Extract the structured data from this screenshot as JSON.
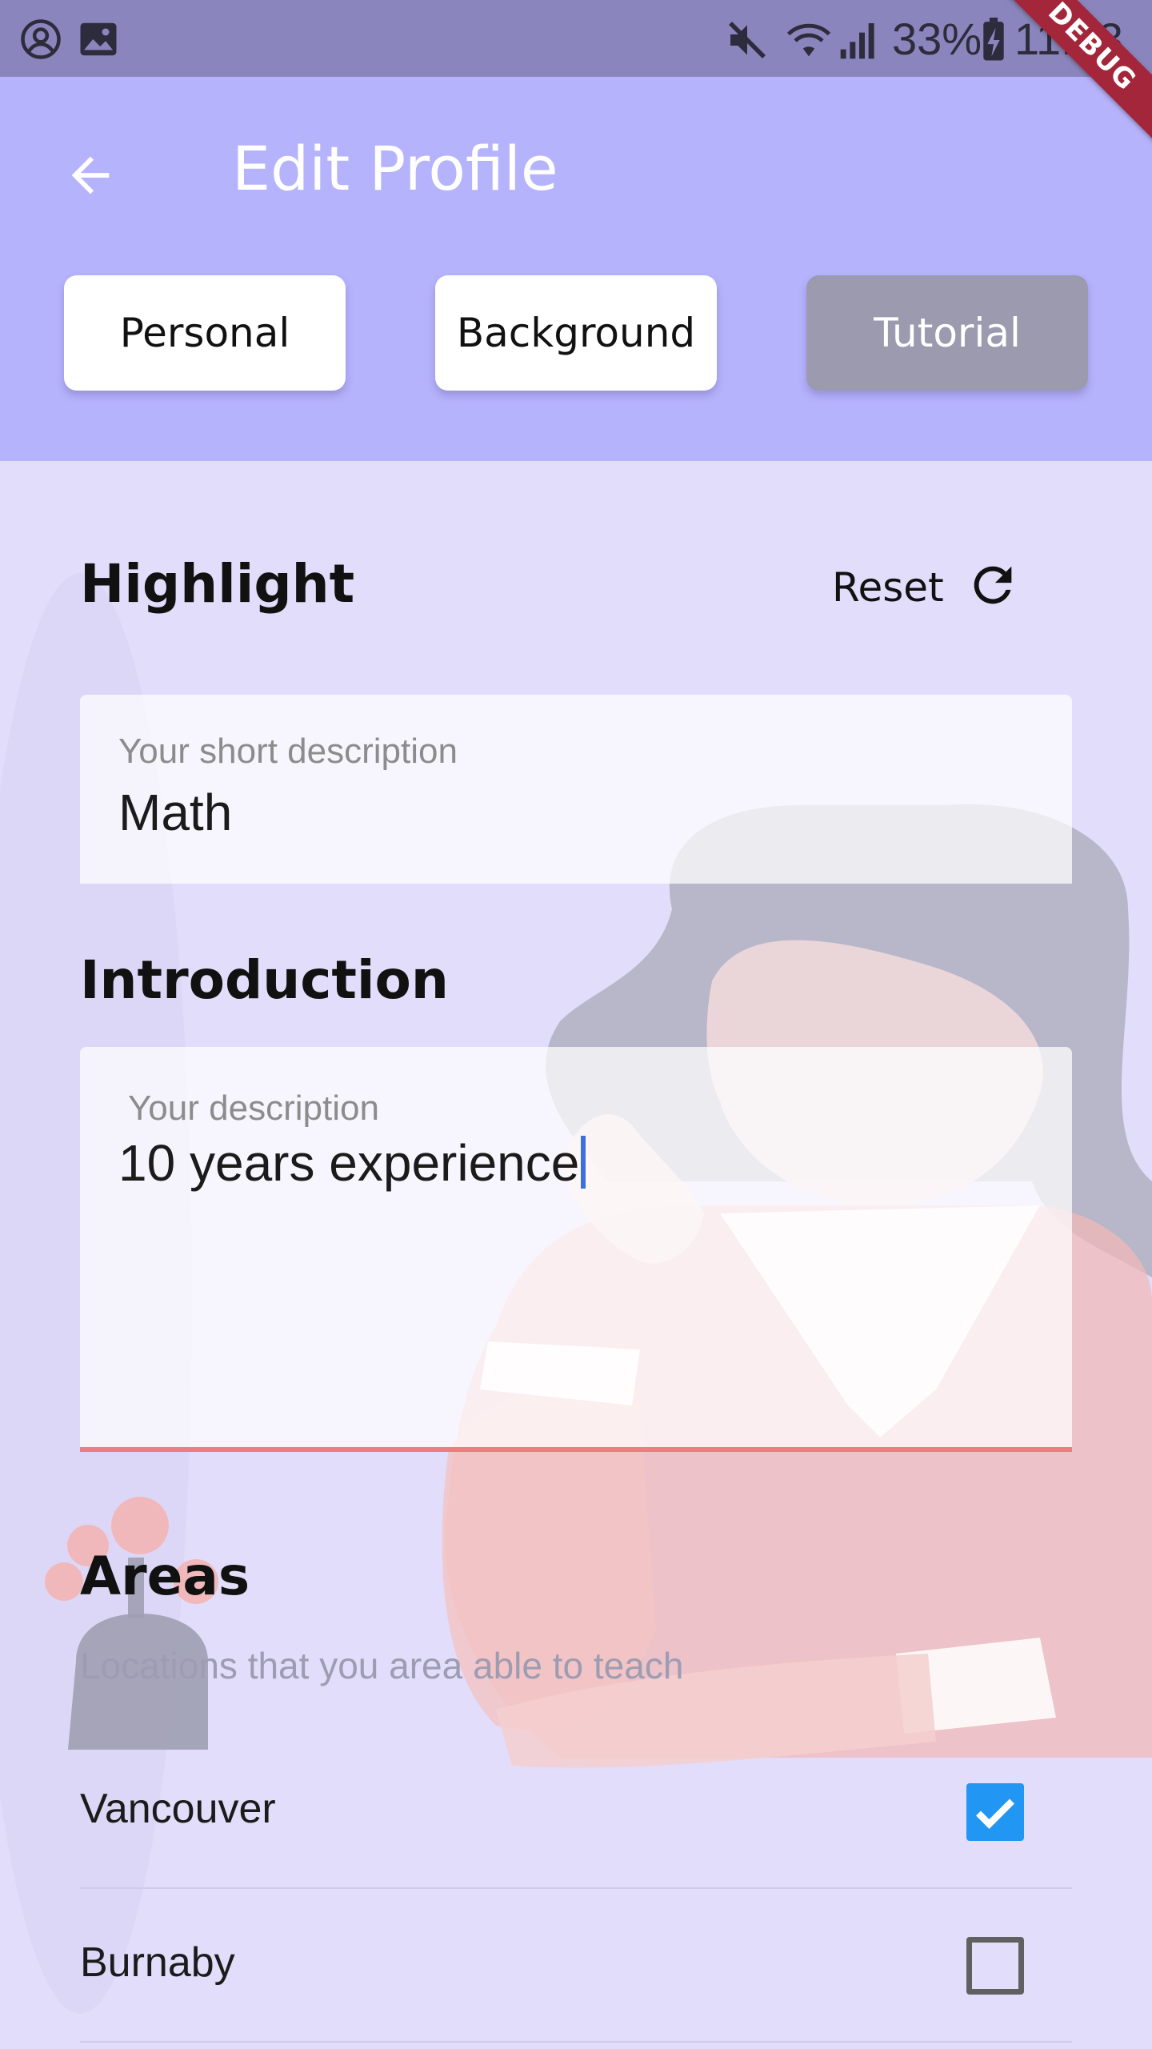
{
  "status_bar": {
    "battery": "33%",
    "time": "11:23",
    "icons": [
      "account-circle-icon",
      "image-icon",
      "mute-icon",
      "wifi-icon",
      "signal-icon",
      "battery-charging-icon"
    ]
  },
  "debug_banner": "DEBUG",
  "app_bar": {
    "title": "Edit Profile",
    "back_icon": "arrow-back-icon"
  },
  "tabs": [
    {
      "label": "Personal",
      "selected": false
    },
    {
      "label": "Background",
      "selected": false
    },
    {
      "label": "Tutorial",
      "selected": true
    }
  ],
  "highlight": {
    "title": "Highlight",
    "reset_label": "Reset",
    "reset_icon": "refresh-icon",
    "field_label": "Your short description",
    "field_value": "Math"
  },
  "introduction": {
    "title": "Introduction",
    "field_label": "Your description",
    "field_value": "10 years experience"
  },
  "areas": {
    "title": "Areas",
    "hint": "Locations that you area able to teach",
    "items": [
      {
        "label": "Vancouver",
        "checked": true
      },
      {
        "label": "Burnaby",
        "checked": false
      }
    ]
  },
  "colors": {
    "app_bar": "#b6b3fd",
    "page_background": "#e1ddfa",
    "status_bar": "#8a86bd",
    "selected_tab": "#9b9aae",
    "checkbox_checked": "#2196f3",
    "field_underline": "#ee7d7f",
    "debug_banner": "#a3263a"
  }
}
